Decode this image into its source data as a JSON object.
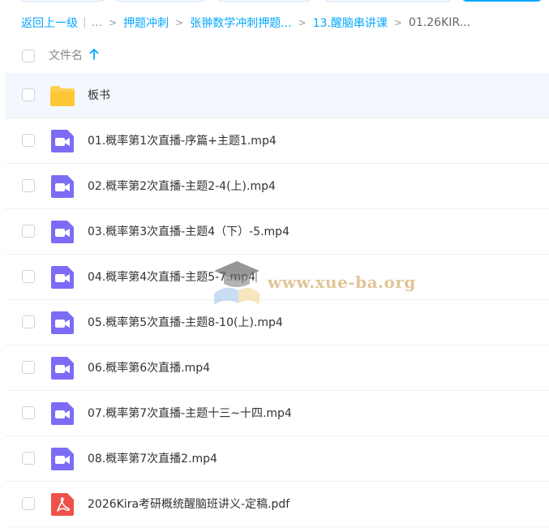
{
  "breadcrumb": {
    "back": "返回上一级",
    "more": "...",
    "items": [
      "押题冲刺",
      "张翀数学冲刺押题...",
      "13.醒脑串讲课"
    ],
    "current": "01.26KIR..."
  },
  "list_header": {
    "name_label": "文件名",
    "sort": "ascending"
  },
  "files": [
    {
      "name": "板书",
      "type": "folder"
    },
    {
      "name": "01.概率第1次直播-序篇+主题1.mp4",
      "type": "video"
    },
    {
      "name": "02.概率第2次直播-主题2-4(上).mp4",
      "type": "video"
    },
    {
      "name": "03.概率第3次直播-主题4（下）-5.mp4",
      "type": "video"
    },
    {
      "name": "04.概率第4次直播-主题5-7.mp4",
      "type": "video"
    },
    {
      "name": "05.概率第5次直播-主题8-10(上).mp4",
      "type": "video"
    },
    {
      "name": "06.概率第6次直播.mp4",
      "type": "video"
    },
    {
      "name": "07.概率第7次直播-主题十三~十四.mp4",
      "type": "video"
    },
    {
      "name": "08.概率第7次直播2.mp4",
      "type": "video"
    },
    {
      "name": "2026Kira考研概统醒脑班讲义-定稿.pdf",
      "type": "pdf"
    }
  ],
  "watermark": "www.xue-ba.org",
  "colors": {
    "accent": "#06a7ff",
    "folder": "#ffd04d",
    "video": "#7c6cf5",
    "pdf": "#f0504a",
    "selected_row": "#f3f8fe"
  }
}
